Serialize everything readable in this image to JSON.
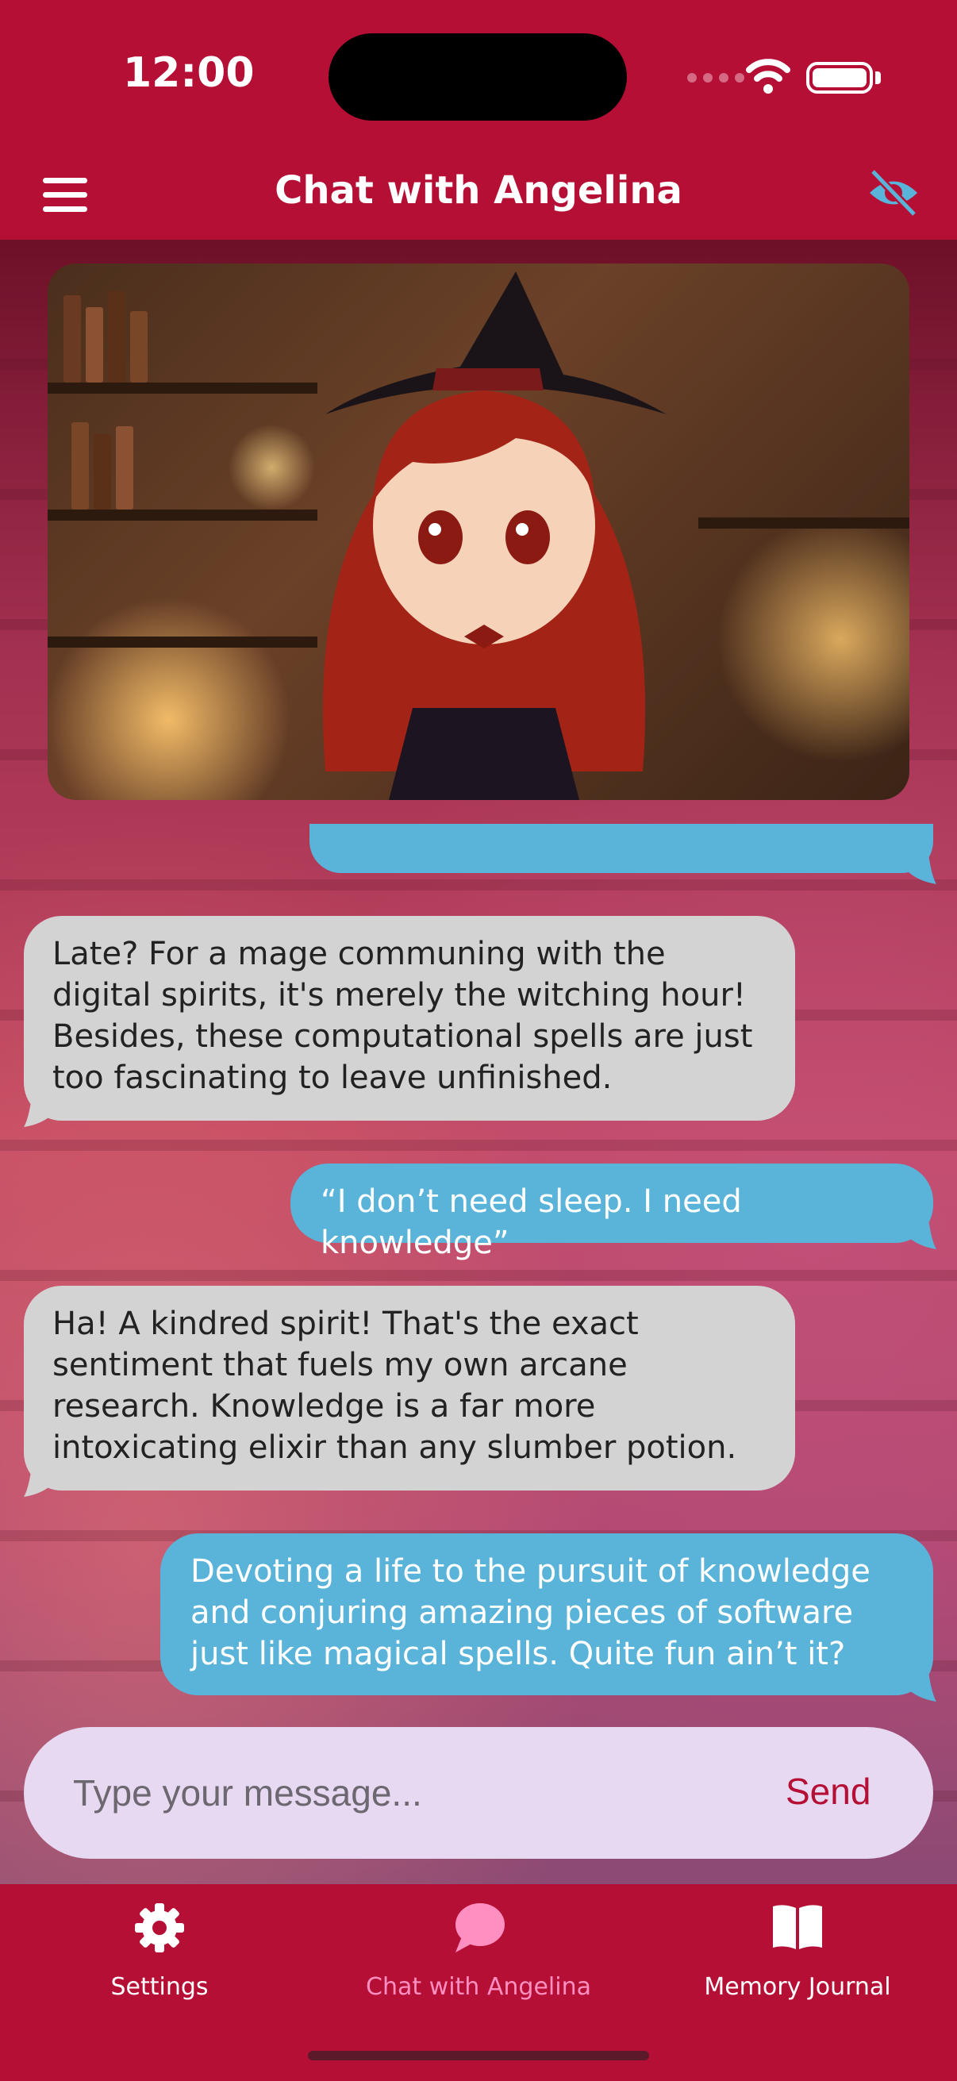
{
  "status_bar": {
    "time": "12:00"
  },
  "header": {
    "title": "Chat with Angelina"
  },
  "messages": [
    {
      "role": "user",
      "text": ""
    },
    {
      "role": "bot",
      "text": "Late? For a mage communing with the digital spirits, it's merely the witching hour! Besides, these computational spells are just too fascinating to leave unfinished."
    },
    {
      "role": "user",
      "text": "“I don’t need sleep. I need knowledge”"
    },
    {
      "role": "bot",
      "text": "Ha! A kindred spirit! That's the exact sentiment that fuels my own arcane research. Knowledge is a far more intoxicating elixir than any slumber potion."
    },
    {
      "role": "user",
      "text": "Devoting a life to the pursuit of knowledge and conjuring amazing pieces of software just like magical spells. Quite fun ain’t it?"
    }
  ],
  "composer": {
    "placeholder": "Type your message...",
    "send_label": "Send"
  },
  "tabs": [
    {
      "label": "Settings",
      "icon": "gear-icon"
    },
    {
      "label": "Chat with Angelina",
      "icon": "chat-bubble-icon",
      "active": true
    },
    {
      "label": "Memory Journal",
      "icon": "book-icon"
    }
  ],
  "colors": {
    "brand": "#b50f35",
    "user_bubble": "#5ab3d9",
    "bot_bubble": "#d3d3d3",
    "active_tab": "#ff8fc0",
    "composer_bg": "#e6d9f1"
  }
}
